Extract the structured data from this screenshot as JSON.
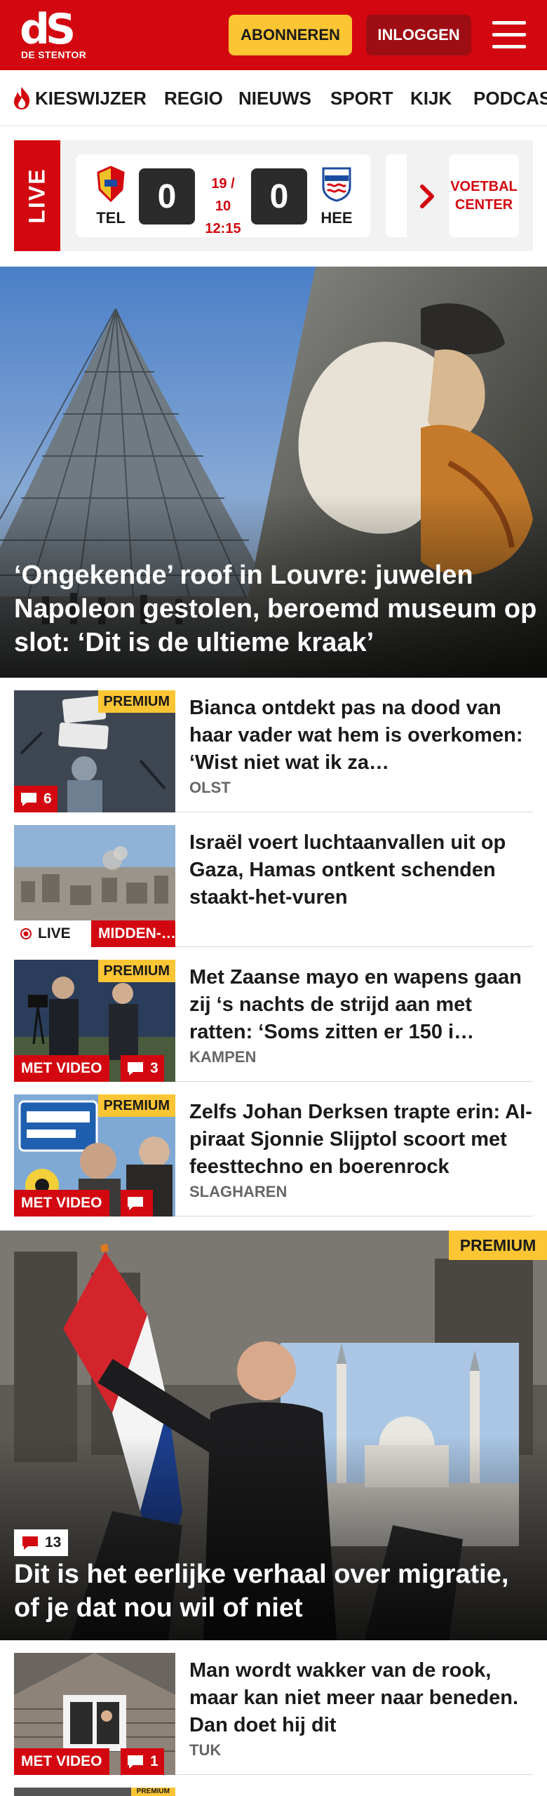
{
  "header": {
    "logo_mark": "dS",
    "logo_sub": "DE STENTOR",
    "subscribe_label": "ABONNEREN",
    "login_label": "INLOGGEN",
    "menu_icon": "hamburger-icon",
    "brand_color": "#d3070f",
    "accent_color": "#fbc534"
  },
  "nav": {
    "items": [
      {
        "label": "KIESWIJZER",
        "icon": "flame-icon"
      },
      {
        "label": "REGIO"
      },
      {
        "label": "NIEUWS"
      },
      {
        "label": "SPORT"
      },
      {
        "label": "KIJK"
      },
      {
        "label": "PODCAS"
      }
    ]
  },
  "live": {
    "label": "LIVE",
    "match": {
      "home_abbr": "TEL",
      "home_score": "0",
      "date": "19 / 10",
      "time": "12:15",
      "away_score": "0",
      "away_abbr": "HEE"
    },
    "next_icon": "chevron-right-icon",
    "voetbal_center_line1": "VOETBAL",
    "voetbal_center_line2": "CENTER"
  },
  "hero": {
    "title": "‘Ongekende’ roof in Louvre: juwelen Napoleon gestolen, beroemd museum op slot: ‘Dit is de ultieme kraak’"
  },
  "articles": [
    {
      "title": "Bianca ontdekt pas na dood van haar vader wat hem is overkomen: ‘Wist niet wat ik za…",
      "location": "OLST",
      "premium": "PREMIUM",
      "comments": "6"
    },
    {
      "title": "Israël voert luchtaanvallen uit op Gaza, Hamas ontkent schenden staakt-het-vuren",
      "live_label": "LIVE",
      "section": "MIDDEN-…"
    },
    {
      "title": "Met Zaanse mayo en wapens gaan zij ‘s nachts de strijd aan met ratten: ‘Soms zitten er 150 i…",
      "location": "KAMPEN",
      "premium": "PREMIUM",
      "video_label": "MET VIDEO",
      "comments": "3"
    },
    {
      "title": "Zelfs Johan Derksen trapte erin: AI-piraat Sjonnie Slijptol scoort met feesttechno en boerenrock",
      "location": "SLAGHAREN",
      "premium": "PREMIUM",
      "video_label": "MET VIDEO",
      "comments": ""
    }
  ],
  "big_card": {
    "premium": "PREMIUM",
    "comments": "13",
    "title": "Dit is het eerlijke verhaal over migratie, of je dat nou wil of niet"
  },
  "bottom_article": {
    "title": "Man wordt wakker van de rook, maar kan niet meer naar beneden. Dan doet hij dit",
    "location": "TUK",
    "video_label": "MET VIDEO",
    "comments": "1"
  },
  "peek_article": {
    "premium": "PREMIUM"
  }
}
